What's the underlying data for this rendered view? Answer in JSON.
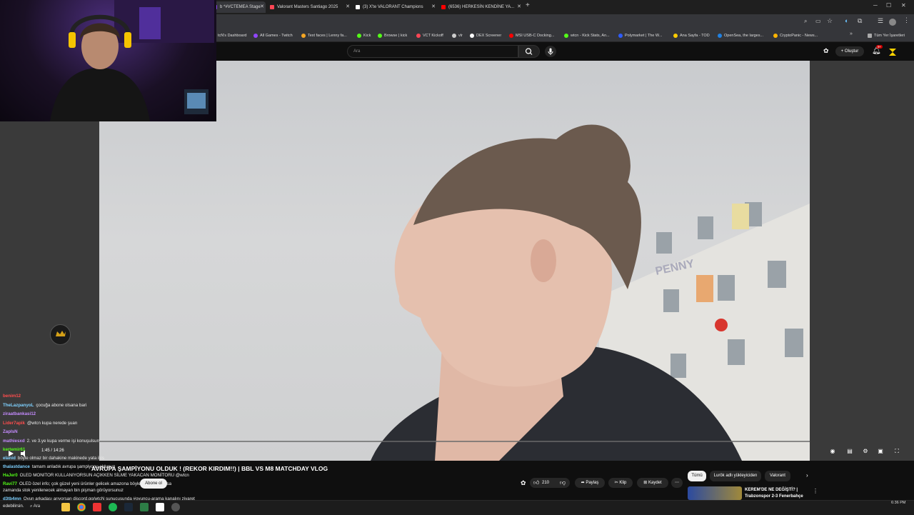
{
  "browser": {
    "tabs": [
      {
        "label": "b *#VCTEMEA Stage",
        "color": "#9146ff"
      },
      {
        "label": "Valorant Masters Santiago 2025",
        "color": "#ff4655"
      },
      {
        "label": "(3) X'te VALORANT Champions",
        "color": "#ffffff"
      },
      {
        "label": "(6536) HERKESİN KENDİNE YA...",
        "color": "#ff0000"
      }
    ],
    "new_tab": "+",
    "bookmarks": [
      {
        "label": "tcN's Dashboard",
        "color": "#9146ff"
      },
      {
        "label": "All Games - Twitch",
        "color": "#9146ff"
      },
      {
        "label": "Text faces | Lenny fa...",
        "color": "#f5a623"
      },
      {
        "label": "Kick",
        "color": "#53fc18"
      },
      {
        "label": "Browse | kick",
        "color": "#53fc18"
      },
      {
        "label": "VCT Kickoff",
        "color": "#ff4655"
      },
      {
        "label": "vlr",
        "color": "#cccccc"
      },
      {
        "label": "DEX Screener",
        "color": "#ffffff"
      },
      {
        "label": "MSI USB-C Docking...",
        "color": "#ff0000"
      },
      {
        "label": "wtcn - Kick Stats, An...",
        "color": "#53fc18"
      },
      {
        "label": "Polymarket | The W...",
        "color": "#2e5cff"
      },
      {
        "label": "Ana Sayfa - TOD",
        "color": "#ffcc00"
      },
      {
        "label": "OpenSea, the larges...",
        "color": "#2081e2"
      },
      {
        "label": "CryptoPanic - News...",
        "color": "#ffb400"
      }
    ],
    "all_bookmarks": "Tüm Yer İşaretleri"
  },
  "youtube": {
    "search_placeholder": "Ara",
    "create_label": "Oluştur",
    "notif_count": "9+",
    "video": {
      "title": "AVRUPA ŞAMPİYONU OLDUK ! (REKOR KIRDIM!!) | BBL VS M8 MATCHDAY VLOG",
      "time": "1:45 / 14:26",
      "overlay_text": "Abone ol",
      "likes": "210",
      "share": "Paylaş",
      "clip": "Klip",
      "save": "Kaydet"
    },
    "chips": [
      "Tümü",
      "Lurök adlı yükleyiciden",
      "Valorant"
    ],
    "suggestion": {
      "title": "KEREM'DE NE DEĞİŞTİ? |",
      "sub": "Trabzonspor 2-3 Fenerbahçe"
    },
    "sign_label": "PENNY"
  },
  "chat": [
    {
      "user": "benim12",
      "text": "",
      "color": "#ff4d4d"
    },
    {
      "user": "TheLazpanyoL",
      "text": "çocuğa abone olsana bari",
      "color": "#7fd1ff"
    },
    {
      "user": "ziraatbankasi12",
      "text": "",
      "color": "#c58bff"
    },
    {
      "user": "Lider7apik",
      "text": "@wtcn kupa nerede şuan",
      "color": "#ff4d4d"
    },
    {
      "user": "ZapIsN",
      "text": "",
      "color": "#c58bff"
    },
    {
      "user": "mathiesxd",
      "text": "2. ve 3.ye kupa verme işi konuşulsun",
      "color": "#c58bff"
    },
    {
      "user": "kertemir61",
      "text": "",
      "color": "#53fc18"
    },
    {
      "user": "elanid",
      "text": "böyle olmaz bir dahakine makinede yata ikis",
      "color": "#7fd1ff"
    },
    {
      "user": "thalastdance",
      "text": "tamam anladık avrupa şampiyonu oldunuz",
      "color": "#7fd1ff"
    },
    {
      "user": "HaJer0",
      "text": "OLED MONITOR KULLANIYORSUN AÇIKKEN SİLME YAKACAN MONİTORU @wtcn",
      "color": "#53fc18"
    },
    {
      "user": "Ravi77",
      "text": "OLED özel info; çok güzel yeni ürünler gelicek amazona böyle diyim + en kısa",
      "color": "#53fc18"
    },
    {
      "user": "",
      "text": "zamanda stok yenilenecek almayan bin pişman görüyorsunuz",
      "color": "#eaeaea"
    },
    {
      "user": "d3tb4mn",
      "text": "Oyun arkadaşı arıyorsan discord.gg/wtcN sunucusunda #oyuncu-arama kanalını ziyaret",
      "color": "#7fd1ff"
    },
    {
      "user": "",
      "text": "edebilirsin.",
      "color": "#eaeaea"
    }
  ],
  "taskbar": {
    "search": "Ara",
    "clock": "6:36 PM"
  }
}
